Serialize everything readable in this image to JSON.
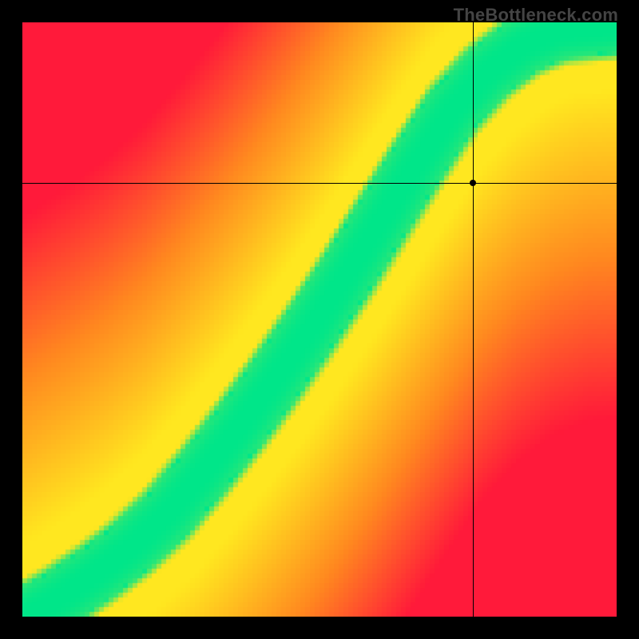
{
  "watermark": "TheBottleneck.com",
  "colors": {
    "red": "#ff1a3a",
    "orange": "#ff8a1f",
    "yellow": "#ffe720",
    "green": "#00e68a"
  },
  "chart_data": {
    "type": "heatmap",
    "title": "",
    "xlabel": "",
    "ylabel": "",
    "xlim": [
      0,
      1
    ],
    "ylim": [
      0,
      1
    ],
    "marker": {
      "x": 0.758,
      "y": 0.73
    },
    "ridge_points": [
      {
        "x": 0.0,
        "y": 0.0
      },
      {
        "x": 0.06,
        "y": 0.035
      },
      {
        "x": 0.12,
        "y": 0.075
      },
      {
        "x": 0.18,
        "y": 0.12
      },
      {
        "x": 0.24,
        "y": 0.175
      },
      {
        "x": 0.3,
        "y": 0.245
      },
      {
        "x": 0.36,
        "y": 0.32
      },
      {
        "x": 0.42,
        "y": 0.4
      },
      {
        "x": 0.48,
        "y": 0.485
      },
      {
        "x": 0.54,
        "y": 0.575
      },
      {
        "x": 0.6,
        "y": 0.67
      },
      {
        "x": 0.66,
        "y": 0.765
      },
      {
        "x": 0.72,
        "y": 0.855
      },
      {
        "x": 0.78,
        "y": 0.92
      },
      {
        "x": 0.84,
        "y": 0.965
      },
      {
        "x": 0.9,
        "y": 0.99
      },
      {
        "x": 1.0,
        "y": 1.0
      }
    ],
    "ridge_green_halfwidth": 0.045,
    "ridge_yellow_halfwidth": 0.11,
    "description": "Heatmap with a curved green ridge rising from bottom-left to top-right, surrounded by yellow then orange then red regions. A black crosshair marks a point in the upper-right yellow region."
  }
}
